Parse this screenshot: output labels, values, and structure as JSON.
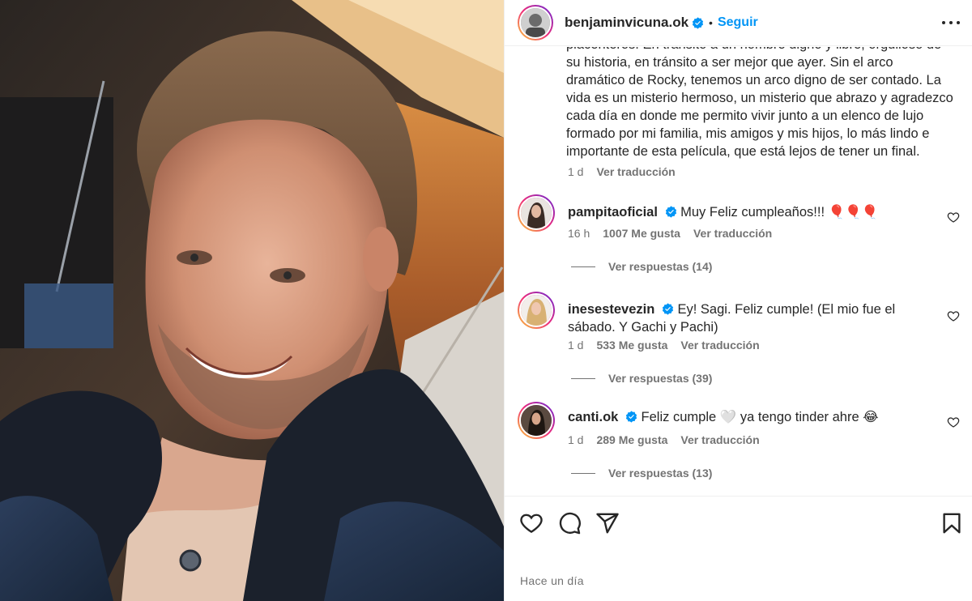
{
  "post": {
    "photo_alt": "benjaminvicuna.ok selfie"
  },
  "header": {
    "username": "benjaminvicuna.ok",
    "separator": "•",
    "follow_label": "Seguir",
    "verified_icon": "verified-badge-icon",
    "more_icon": "more-options-icon"
  },
  "caption": {
    "partial_line": "placenteros. En tránsito a un hombre digno y libre, orgulloso de",
    "text": "su historia, en tránsito a ser mejor que ayer. Sin el arco dramático de Rocky, tenemos un arco digno de ser contado. La vida es un misterio hermoso, un misterio que abrazo y agradezco cada día en donde me permito vivir junto a un elenco de lujo formado por mi familia, mis amigos y mis hijos, lo más lindo e importante de esta película, que está lejos de tener un final.",
    "time": "1 d",
    "translate_label": "Ver traducción"
  },
  "comments": [
    {
      "username": "pampitaoficial",
      "text": "Muy Feliz cumpleaños!!! 🎈🎈🎈",
      "time": "16 h",
      "likes": "1007 Me gusta",
      "translate_label": "Ver traducción",
      "replies_label": "Ver respuestas (14)"
    },
    {
      "username": "inesestevezin",
      "text": "Ey! Sagi. Feliz cumple! (El mio fue el sábado. Y Gachi y Pachi)",
      "time": "1 d",
      "likes": "533 Me gusta",
      "translate_label": "Ver traducción",
      "replies_label": "Ver respuestas (39)"
    },
    {
      "username": "canti.ok",
      "text": "Feliz cumple 🤍 ya tengo tinder ahre 😂",
      "time": "1 d",
      "likes": "289 Me gusta",
      "translate_label": "Ver traducción",
      "replies_label": "Ver respuestas (13)"
    }
  ],
  "actions": {
    "like_icon": "heart-icon",
    "comment_icon": "comment-icon",
    "share_icon": "share-icon",
    "save_icon": "bookmark-icon",
    "posted_time": "Hace un día"
  },
  "colors": {
    "link_blue": "#0095f6",
    "secondary_text": "#737373",
    "primary_text": "#262626",
    "verified_blue": "#0095f6"
  }
}
